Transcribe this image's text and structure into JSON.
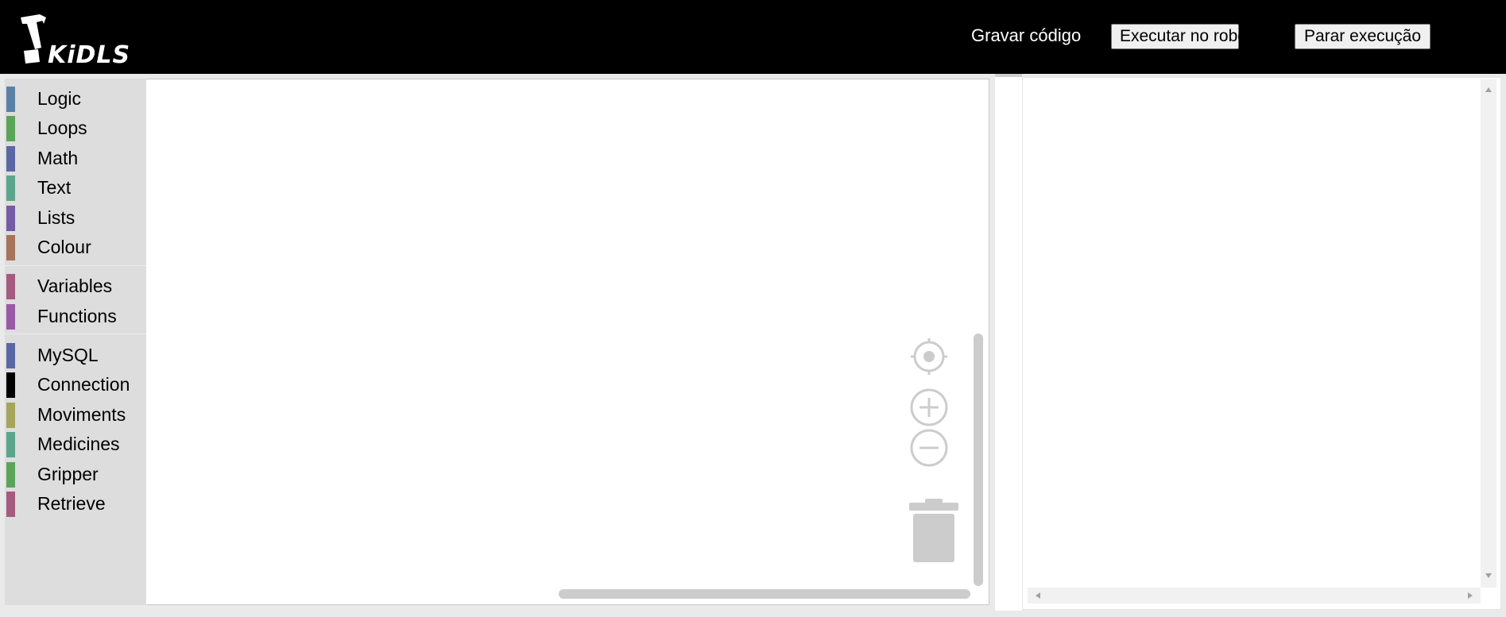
{
  "header": {
    "logo_text": "KiDLS",
    "save_code_label": "Gravar código",
    "run_label": "Executar no robô",
    "stop_label": "Parar execução"
  },
  "toolbox": {
    "categories": [
      {
        "label": "Logic",
        "color": "#5b80a5"
      },
      {
        "label": "Loops",
        "color": "#5ba55b"
      },
      {
        "label": "Math",
        "color": "#5b67a5"
      },
      {
        "label": "Text",
        "color": "#5ba58c"
      },
      {
        "label": "Lists",
        "color": "#745ba5"
      },
      {
        "label": "Colour",
        "color": "#a5745b"
      },
      {
        "label": "Variables",
        "color": "#a55b80"
      },
      {
        "label": "Functions",
        "color": "#995ba5"
      },
      {
        "label": "MySQL",
        "color": "#5b67a5"
      },
      {
        "label": "Connection",
        "color": "#000000"
      },
      {
        "label": "Moviments",
        "color": "#a5a55b"
      },
      {
        "label": "Medicines",
        "color": "#5ba58c"
      },
      {
        "label": "Gripper",
        "color": "#5ba55b"
      },
      {
        "label": "Retrieve",
        "color": "#a55b80"
      }
    ]
  },
  "workspace_controls": {
    "recenter_icon": "crosshair-icon",
    "zoom_in_icon": "plus-circle-icon",
    "zoom_out_icon": "minus-circle-icon",
    "trash_icon": "trash-icon"
  },
  "colors": {
    "topbar_bg": "#000000",
    "toolbox_bg": "#dddddd",
    "control_gray": "#cccccc"
  }
}
